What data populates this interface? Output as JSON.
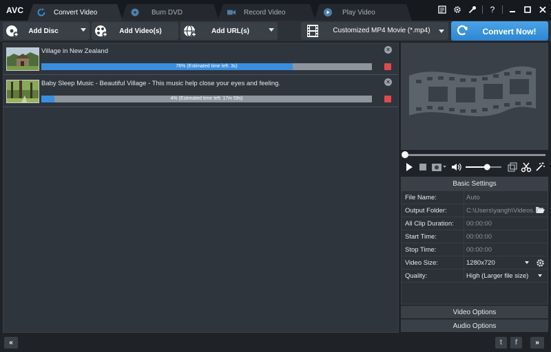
{
  "app": {
    "logo": "AVC"
  },
  "tabs": [
    {
      "label": "Convert Video",
      "active": true,
      "icon": "refresh-icon"
    },
    {
      "label": "Burn DVD",
      "active": false,
      "icon": "disc-icon"
    },
    {
      "label": "Record Video",
      "active": false,
      "icon": "camera-icon"
    },
    {
      "label": "Play Video",
      "active": false,
      "icon": "play-icon"
    }
  ],
  "window_controls": [
    "register-icon",
    "gear-icon",
    "key-icon",
    "help-icon",
    "minimize-icon",
    "maximize-icon",
    "close-icon"
  ],
  "window_help": "?",
  "toolbar": {
    "add_disc": "Add Disc",
    "add_videos": "Add Video(s)",
    "add_urls": "Add URL(s)",
    "format": "Customized MP4 Movie (*.mp4)",
    "convert": "Convert Now!"
  },
  "files": [
    {
      "title": "Village in New Zealand",
      "progress": 0.76,
      "progress_text": "76% (Estimated time left: 3s)"
    },
    {
      "title": "Baby Sleep Music - Beautiful Village - This music help close your eyes and feeling.",
      "progress": 0.04,
      "progress_text": "4% (Estimated time left: 17m 59s)"
    }
  ],
  "player": {
    "seek_position": 0,
    "volume": 0.6
  },
  "settings": {
    "header": "Basic Settings",
    "rows": [
      {
        "key": "File Name:",
        "value": "Auto"
      },
      {
        "key": "Output Folder:",
        "value": "C:\\Users\\yangh\\Videos..."
      },
      {
        "key": "All Clip Duration:",
        "value": "00:00:00"
      },
      {
        "key": "Start Time:",
        "value": "00:00:00"
      },
      {
        "key": "Stop Time:",
        "value": "00:00:00"
      },
      {
        "key": "Video Size:",
        "value": "1280x720"
      },
      {
        "key": "Quality:",
        "value": "High (Larger file size)"
      }
    ],
    "video_options": "Video Options",
    "audio_options": "Audio Options"
  },
  "footer": {
    "collapse": "«",
    "expand": "»",
    "twitter": "t",
    "facebook": "f"
  },
  "colors": {
    "accent": "#3a8ee0",
    "stop": "#e04a4a",
    "convert": "#2f86d2"
  }
}
